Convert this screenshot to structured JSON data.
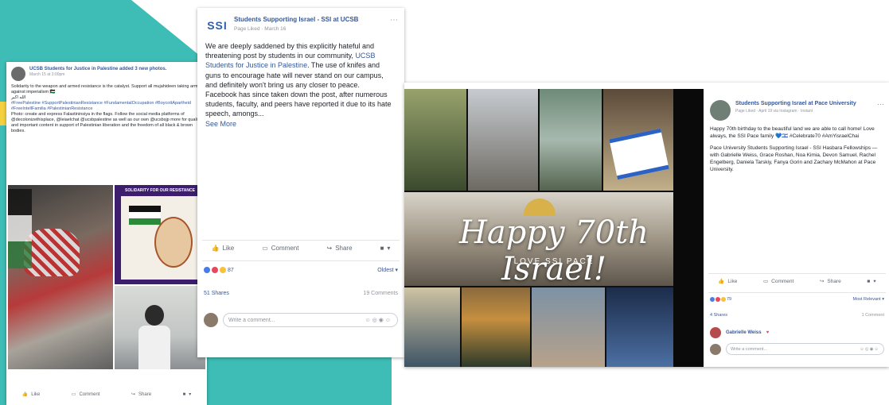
{
  "post1": {
    "header": "UCSB Students for Justice in Palestine added 3 new photos.",
    "time": "March 15 at 3:00pm",
    "body1": "Solidarity to the weapon and armed resistance is the catalyst. Support all mujahideen taking arms against imperialism 🇵🇸",
    "body2": "الله اكبر",
    "tags": "#FreePalestine #SupportPalestinianResistance #FundamentalOccupation #BoycottApartheid #FreeIntellFamilia #PalestinianResistance",
    "body3": "Photo: create and express Falastininsiya in the flags. Follow the social media platforms of @decolonizethisplace, @leiaelchat @ucsbpalestine as well as our own @ucsbsjp more for quality and important content in support of Palestinian liberation and the freedom of all black & brown bodies.",
    "photo_caption": "SOLIDARITY FOR OUR RESISTANCE",
    "like": "Like",
    "comment": "Comment",
    "share": "Share"
  },
  "post2": {
    "page_name": "Students Supporting Israel - SSI at UCSB",
    "logo_text": "SSI",
    "time": "Page Liked · March 16",
    "body_a": "We are deeply saddened by this explicitly hateful and threatening post by students in our community, ",
    "mention": "UCSB Students for Justice in Palestine",
    "body_b": ". The use of knifes and guns to encourage hate will never stand on our campus, and definitely won't bring us any closer to peace.",
    "body_c": "Facebook has since taken down the post, after numerous students, faculty, and peers have reported it due to its hate speech, amongs...",
    "see_more": "See More",
    "like": "Like",
    "comment": "Comment",
    "share": "Share",
    "reaction_count": "87",
    "oldest": "Oldest",
    "shares": "51 Shares",
    "comments": "19 Comments",
    "write_comment": "Write a comment..."
  },
  "post3": {
    "page_name": "Students Supporting Israel at Pace University",
    "time": "Page Liked · April 19 via Instagram · Instant",
    "body": "Happy 70th birthday to the beautiful land we are able to call home! Love always, the SSI Pace family 💙🇮🇱 #Celebrate70 #AmYisraelChai",
    "body2": "Pace University Students Supporting Israel - SSI Hasbara Fellowships — with Gabrielle Weiss, Grace Roshan, Noa Kimia, Devon Samuel, Rachel Engelberg, Daniela Tarskiy, Fanya Gorin and Zachary McMahon at Pace University.",
    "collage_title": "Happy 70th Israel!",
    "collage_subtitle": "LOVE SSI PACE",
    "like": "Like",
    "comment": "Comment",
    "share": "Share",
    "reaction_count": "79",
    "most_relevant": "Most Relevant",
    "shares": "4 Shares",
    "comments": "1 Comment",
    "commenter": "Gabrielle Weiss",
    "write_comment": "Write a comment..."
  },
  "colors": {
    "teal": "#3dbdb6",
    "fb_link": "#365899",
    "yellow": "#f4d03f"
  }
}
